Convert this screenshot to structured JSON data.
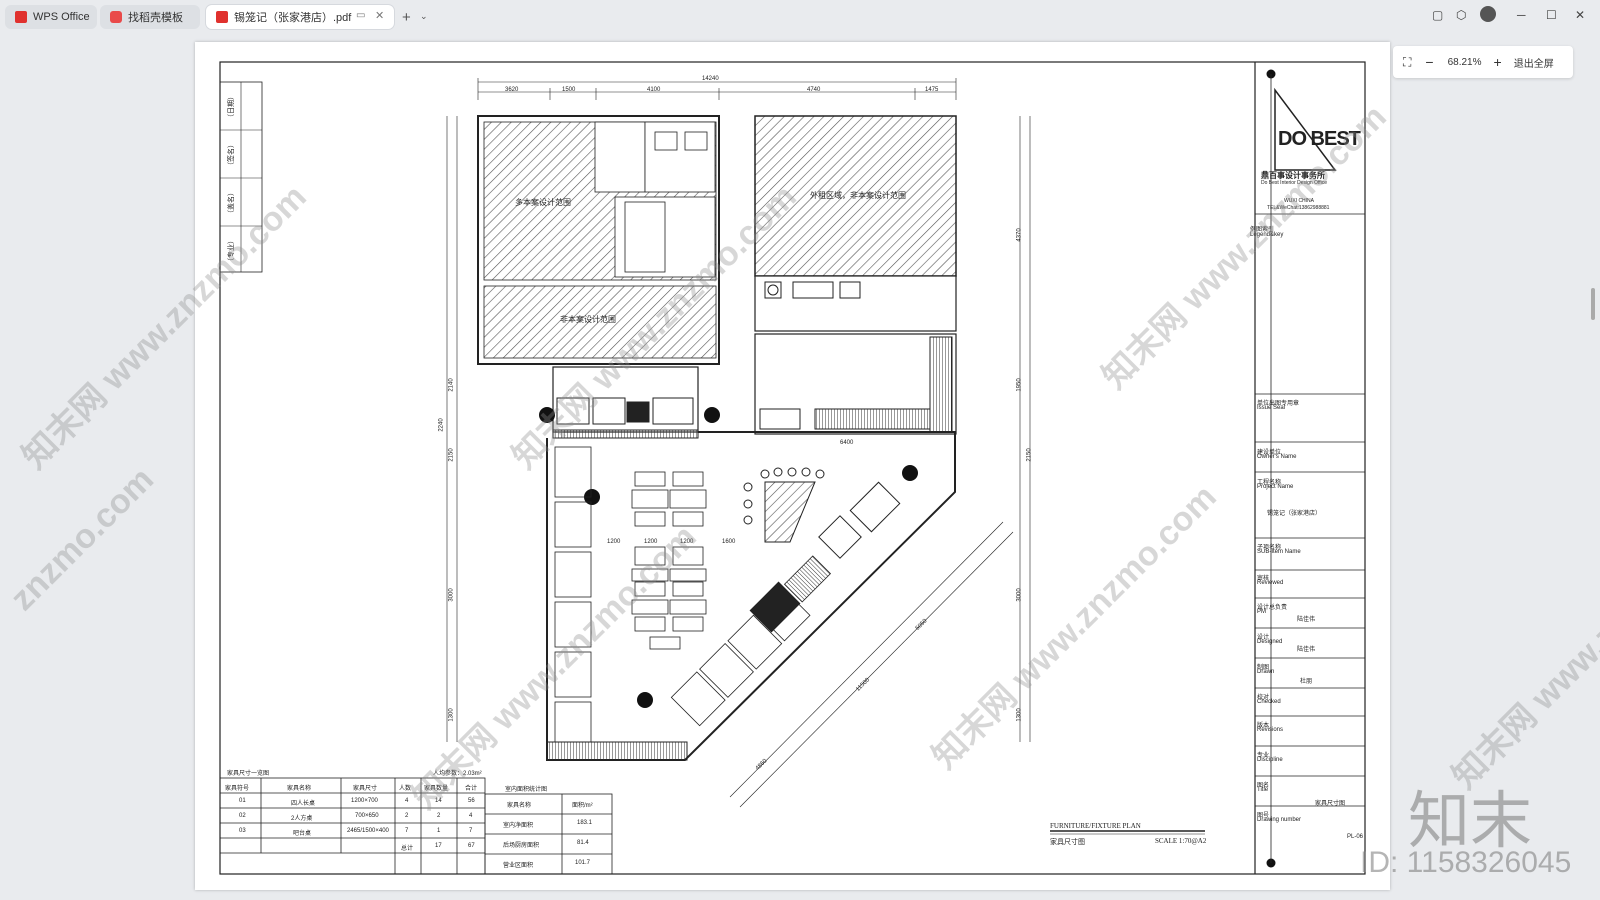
{
  "tabs": [
    {
      "label": "WPS Office"
    },
    {
      "label": "找稻壳模板"
    },
    {
      "label": "锡笼记（张家港店）.pdf"
    }
  ],
  "zoom": {
    "value": "68.21%",
    "exit_label": "退出全屏"
  },
  "drawing": {
    "dims_top": [
      "14240",
      "3620",
      "1500",
      "4100",
      "4740",
      "1475"
    ],
    "dims_left": [
      "2240",
      "2150",
      "3000",
      "1300",
      "2140"
    ],
    "dims_right": [
      "4370",
      "1950",
      "2150",
      "3000",
      "1300"
    ],
    "dims_misc": [
      "6400",
      "1600",
      "1200",
      "1200",
      "1200",
      "11500",
      "4860",
      "5050"
    ],
    "zones": [
      "多本案设计范围",
      "外租区域，非本案设计范围",
      "非本案设计范围"
    ],
    "seal_labels": [
      "（日期）",
      "（签名）",
      "（盖名）",
      "（专业）"
    ],
    "table_furniture": {
      "title": "家具尺寸一览图",
      "avg_label": "人均参数：2.03m²",
      "headers": [
        "家具符号",
        "家具名称",
        "家具尺寸",
        "人数",
        "家具数量",
        "合计"
      ],
      "rows": [
        [
          "01",
          "四人长桌",
          "1200×700",
          "4",
          "14",
          "56"
        ],
        [
          "02",
          "2人方桌",
          "700×650",
          "2",
          "2",
          "4"
        ],
        [
          "03",
          "吧台桌",
          "2465/1500×400",
          "7",
          "1",
          "7"
        ]
      ],
      "total": [
        "总计",
        "17",
        "67"
      ]
    },
    "table_area": {
      "title": "室内面积统计图",
      "headers": [
        "家具名称",
        "面积/m²"
      ],
      "rows": [
        [
          "室内净面积",
          "183.1"
        ],
        [
          "后场厨房面积",
          "81.4"
        ],
        [
          "营业区面积",
          "101.7"
        ]
      ]
    },
    "plan_title": "FURNITURE/FIXTURE PLAN",
    "plan_subtitle": "家具尺寸图",
    "scale": "SCALE  1:70@A2"
  },
  "title_block": {
    "logo": "DO BEST",
    "firm_cn": "鼎百事设计事务所",
    "firm_en": "Do Best Interior Design Office",
    "city": "WUXI CHINA",
    "contact": "TEL&WeChat:13862988881",
    "legend_cn": "例图索引",
    "legend_en": "Legend&key",
    "fields": [
      {
        "cn": "单位出图专用章",
        "en": "Issue Seal",
        "value": ""
      },
      {
        "cn": "建设单位",
        "en": "Owner's Name",
        "value": ""
      },
      {
        "cn": "工程名称",
        "en": "Project Name",
        "value": "锡笼记（张家港店）"
      },
      {
        "cn": "子项名称",
        "en": "SUB-Item Name",
        "value": ""
      },
      {
        "cn": "审核",
        "en": "Reviewed",
        "value": ""
      },
      {
        "cn": "设计总负责",
        "en": "PM",
        "value": "陆佳伟"
      },
      {
        "cn": "设计",
        "en": "Designed",
        "value": "陆佳伟"
      },
      {
        "cn": "制图",
        "en": "Drawn",
        "value": "杜朋"
      },
      {
        "cn": "校对",
        "en": "Checked",
        "value": ""
      },
      {
        "cn": "版本",
        "en": "Revisions",
        "value": ""
      },
      {
        "cn": "专业",
        "en": "Discipline",
        "value": ""
      },
      {
        "cn": "图名",
        "en": "Title",
        "value": "家具尺寸图"
      },
      {
        "cn": "图号",
        "en": "Drawing number",
        "value": "PL-06"
      }
    ]
  },
  "watermarks": [
    "知末网 www.znzmo.com",
    "知末网 www.znzmo.com",
    "知末网 www.znzmo.com",
    "知末网 www.znzmo.com",
    "znzmo.com",
    "知末网 www.znzmo.com",
    "知末网 www.znzmo.com"
  ],
  "brand": {
    "logo": "知末",
    "id": "ID: 1158326045"
  },
  "colors": {
    "accent": "#e0312e",
    "line": "#222222",
    "hatch": "#555555"
  }
}
